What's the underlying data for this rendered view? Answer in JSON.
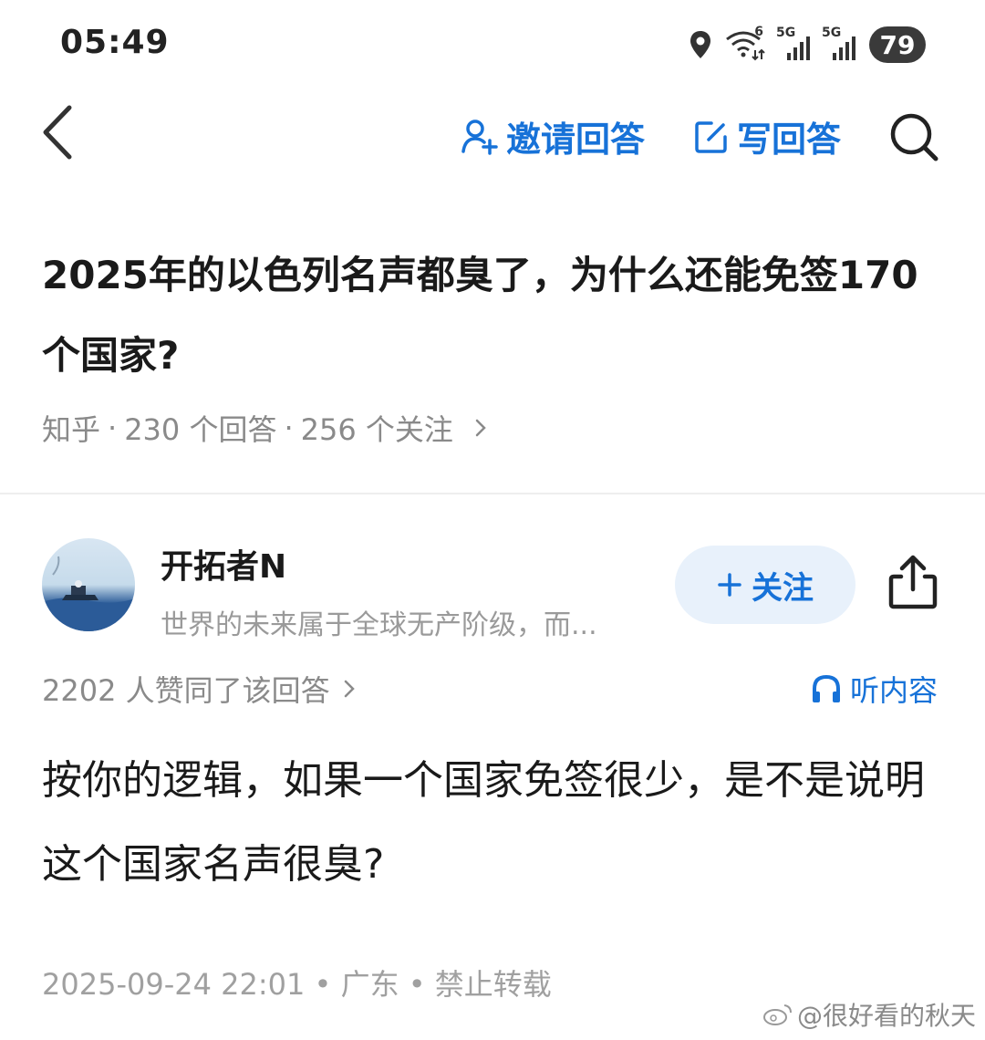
{
  "status_bar": {
    "time": "05:49",
    "network_1": "5G",
    "network_2": "5G",
    "wifi_badge": "6",
    "battery": "79"
  },
  "nav": {
    "invite_label": "邀请回答",
    "write_label": "写回答",
    "accent_color": "#1772d8"
  },
  "question": {
    "title": "2025年的以色列名声都臭了，为什么还能免签170个国家?",
    "source": "知乎",
    "answers_count": "230 个回答",
    "followers_count": "256 个关注"
  },
  "author": {
    "name": "开拓者N",
    "bio": "世界的未来属于全球无产阶级，而...",
    "follow_label": "关注"
  },
  "answer": {
    "likes_text": "2202 人赞同了该回答",
    "listen_label": "听内容",
    "content": "按你的逻辑，如果一个国家免签很少，是不是说明这个国家名声很臭?",
    "footer": "2025-09-24 22:01 • 广东 • 禁止转载"
  },
  "watermark": {
    "text": "@很好看的秋天"
  }
}
